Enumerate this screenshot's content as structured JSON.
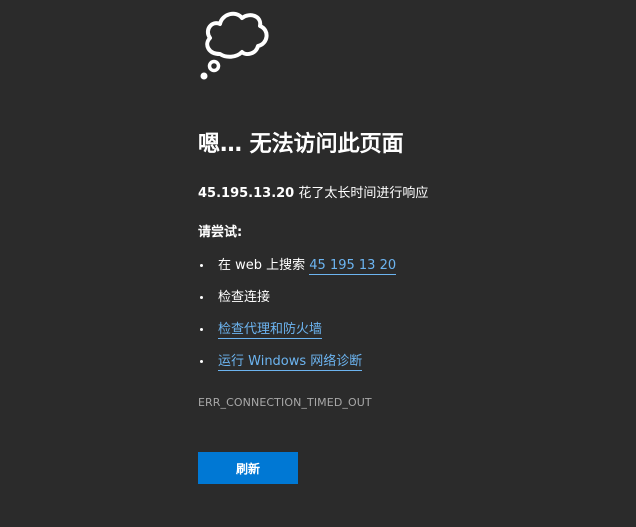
{
  "error_page": {
    "icon": "thought-cloud-icon",
    "title": "嗯… 无法访问此页面",
    "message": {
      "host": "45.195.13.20",
      "text": " 花了太长时间进行响应"
    },
    "try_label": "请尝试:",
    "suggestions": [
      {
        "prefix": "在 web 上搜索 ",
        "link": "45 195 13 20"
      },
      {
        "prefix": "检查连接",
        "link": ""
      },
      {
        "prefix": "",
        "link": "检查代理和防火墙"
      },
      {
        "prefix": "",
        "link": "运行 Windows 网络诊断"
      }
    ],
    "error_code": "ERR_CONNECTION_TIMED_OUT",
    "refresh_label": "刷新"
  },
  "colors": {
    "background": "#2b2b2b",
    "text": "#ffffff",
    "link": "#6cb4f0",
    "error_code": "#a8a8a8",
    "button": "#0078d4"
  }
}
